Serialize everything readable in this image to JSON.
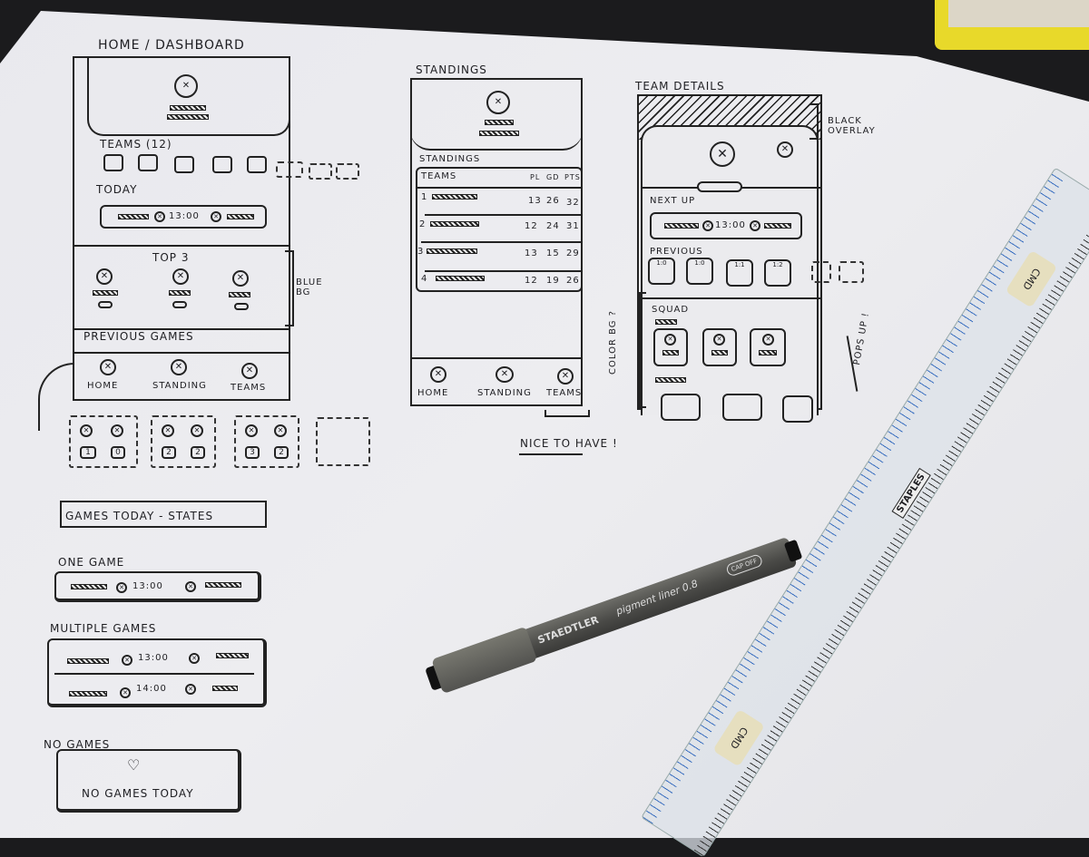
{
  "home": {
    "title": "HOME / DASHBOARD",
    "teams_label": "TEAMS (12)",
    "today_label": "TODAY",
    "today_time": "13:00",
    "top3_label": "TOP 3",
    "previous_label": "PREVIOUS GAMES",
    "annotation": "BLUE BG",
    "nav": [
      "HOME",
      "STANDING",
      "TEAMS"
    ],
    "previous_cards": [
      [
        "1",
        "0"
      ],
      [
        "2",
        "2"
      ],
      [
        "3",
        "2"
      ]
    ]
  },
  "standings": {
    "title": "STANDINGS",
    "section": "STANDINGS",
    "headers": [
      "TEAMS",
      "PL",
      "GD",
      "PTS"
    ],
    "rows": [
      [
        "1",
        "13",
        "26",
        "32"
      ],
      [
        "2",
        "12",
        "24",
        "31"
      ],
      [
        "3",
        "13",
        "15",
        "29"
      ],
      [
        "4",
        "12",
        "19",
        "26"
      ]
    ],
    "nav": [
      "HOME",
      "STANDING",
      "TEAMS"
    ],
    "note": "NICE TO HAVE !"
  },
  "team_details": {
    "title": "TEAM DETAILS",
    "overlay_note": "BLACK OVERLAY",
    "next_up": "NEXT UP",
    "time": "13:00",
    "previous": "PREVIOUS",
    "previous_scores": [
      "1:0",
      "1:0",
      "1:1",
      "1:2"
    ],
    "squad": "SQUAD",
    "color_note": "COLOR BG ?",
    "popup_note": "POPS UP !"
  },
  "states": {
    "title": "GAMES TODAY - STATES",
    "one_game": "ONE GAME",
    "one_time": "13:00",
    "multiple": "MULTIPLE GAMES",
    "multi_times": [
      "13:00",
      "14:00"
    ],
    "no_games": "NO GAMES",
    "no_games_text": "NO GAMES TODAY"
  },
  "objects": {
    "pen_brand": "STAEDTLER",
    "pen_model": "pigment liner 0.8",
    "pen_cap": "CAP OFF",
    "ruler_brand": "STAPLES",
    "ruler_sticker": "CMD"
  }
}
